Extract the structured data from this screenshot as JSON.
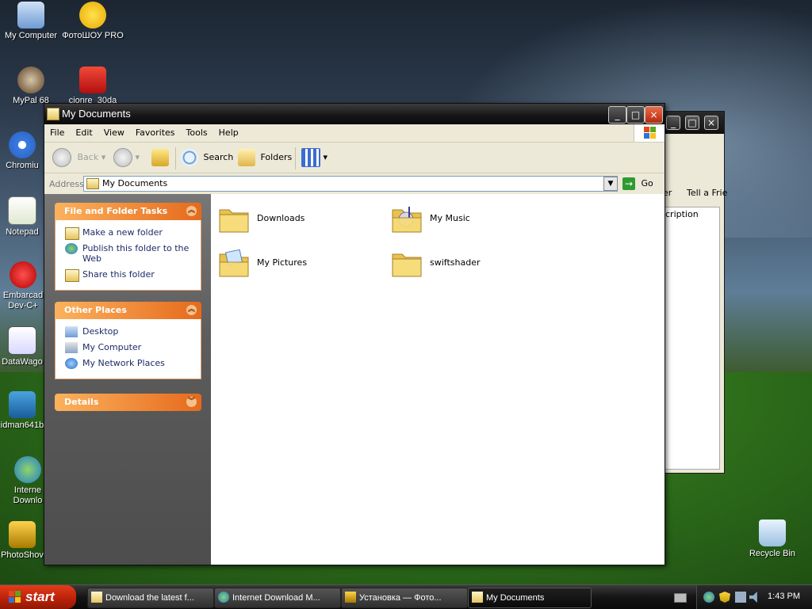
{
  "desktop": {
    "icons": [
      {
        "label": "My Computer"
      },
      {
        "label": "ФотоШОУ PRO"
      },
      {
        "label": "MyPal 68"
      },
      {
        "label": "cionre_30da"
      },
      {
        "label": "Chromiu"
      },
      {
        "label": "Notepad"
      },
      {
        "label": "Embarcad Dev-C+"
      },
      {
        "label": "DataWago"
      },
      {
        "label": "idman641b"
      },
      {
        "label": "Interne Downlo"
      },
      {
        "label": "PhotoShov"
      },
      {
        "label": "Recycle Bin"
      }
    ]
  },
  "back_window": {
    "toolbar_labels": [
      "er",
      "Tell a Frie"
    ],
    "column_header": "cription"
  },
  "window": {
    "title": "My Documents",
    "menu": [
      "File",
      "Edit",
      "View",
      "Favorites",
      "Tools",
      "Help"
    ],
    "toolbar": {
      "back": "Back",
      "search": "Search",
      "folders": "Folders"
    },
    "address": {
      "label": "Address",
      "value": "My Documents",
      "go": "Go"
    },
    "panels": {
      "file_tasks": {
        "title": "File and Folder Tasks",
        "items": [
          "Make a new folder",
          "Publish this folder to the Web",
          "Share this folder"
        ]
      },
      "other_places": {
        "title": "Other Places",
        "items": [
          "Desktop",
          "My Computer",
          "My Network Places"
        ]
      },
      "details": {
        "title": "Details"
      }
    },
    "folders": [
      {
        "name": "Downloads"
      },
      {
        "name": "My Music"
      },
      {
        "name": "My Pictures"
      },
      {
        "name": "swiftshader"
      }
    ]
  },
  "taskbar": {
    "start": "start",
    "tasks": [
      {
        "label": "Download the latest f..."
      },
      {
        "label": "Internet Download M..."
      },
      {
        "label": "Установка — Фото..."
      },
      {
        "label": "My Documents"
      }
    ],
    "clock": "1:43 PM"
  }
}
